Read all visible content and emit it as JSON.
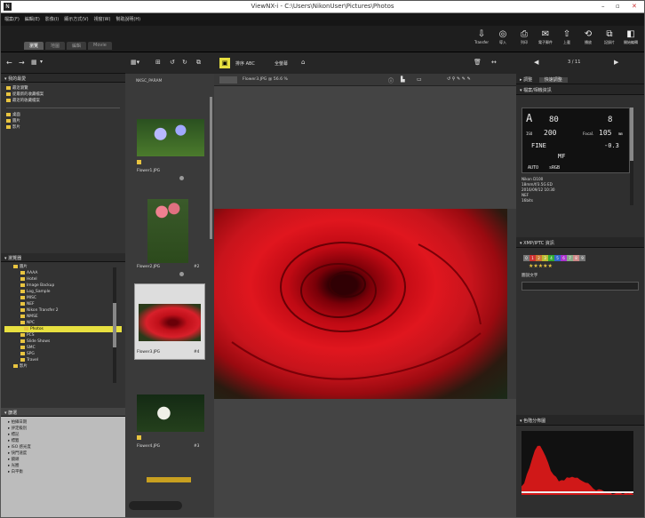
{
  "window": {
    "title": "ViewNX-i - C:\\Users\\NikonUser\\Pictures\\Photos",
    "controls": [
      "–",
      "▫",
      "✕"
    ]
  },
  "menus": [
    "檔案(F)",
    "編輯(E)",
    "影像(I)",
    "顯示方式(V)",
    "視窗(W)",
    "幫助說明(H)"
  ],
  "tabs": [
    "瀏覽",
    "地圖",
    "編輯",
    "Movie"
  ],
  "toolbar": [
    {
      "icon": "transfer-icon",
      "label": "Transfer"
    },
    {
      "icon": "globe-icon",
      "label": "導入"
    },
    {
      "icon": "print-icon",
      "label": "列印"
    },
    {
      "icon": "mail-icon",
      "label": "電子郵件"
    },
    {
      "icon": "upload-icon",
      "label": "上載"
    },
    {
      "icon": "rotate-icon",
      "label": "播放"
    },
    {
      "icon": "copy-icon",
      "label": "記錄片"
    },
    {
      "icon": "nx-icon",
      "label": "開始編輯"
    }
  ],
  "left": {
    "nav": [
      "←",
      "→",
      "▦",
      "▾"
    ],
    "fav_header": "我的最愛",
    "fav_items": [
      "最近瀏覽",
      "從最新的收藏檔案",
      "最近的收藏檔案"
    ],
    "fav2": [
      "桌面",
      "圖片",
      "影片"
    ],
    "folders_header": "瀏覽器",
    "tree": [
      "圖片",
      "AAAA",
      "Hotel",
      "Image Backup",
      "Log_Sample",
      "MISC",
      "NEF",
      "Nikon Transfer 2",
      "NMSE",
      "NPC",
      "Photos",
      "PCS",
      "Slide Shows",
      "SMC",
      "SPG",
      "Travel",
      "影片"
    ],
    "filter_header": "篩選",
    "filters": [
      "拍攝日期",
      "評定級別",
      "標記",
      "標籤",
      "ISO 感光度",
      "快門速度",
      "鏡頭",
      "光圈",
      "白平衡"
    ]
  },
  "strip": {
    "folder": "NKSC_PARAM",
    "thumbs": [
      {
        "name": "Flower1.JPG",
        "count": ""
      },
      {
        "name": "Flower2.JPG",
        "count": "#2"
      },
      {
        "name": "Flower3.JPG",
        "count": "#4"
      },
      {
        "name": "Flower4.JPG",
        "count": "#3"
      }
    ]
  },
  "viewer": {
    "mode": "排序 ABC",
    "file": "Flower3.JPG @ 56.6 %",
    "zoom": "56.6 %",
    "tool_labels": [
      "全螢幕",
      "比較"
    ]
  },
  "right": {
    "nav": "3 / 11",
    "adjust_header": "調整",
    "adjust_value": "快速調整",
    "info_header": "檔案/相機資訊",
    "lcd": {
      "mode": "A",
      "shutter": "80",
      "aperture": "8",
      "iso_label": "ISO",
      "iso": "200",
      "focal_label": "Focal",
      "focal": "105",
      "focal_unit": "mm",
      "quality": "FINE",
      "ev": "-0.3",
      "mf": "MF",
      "wb": "AUTO",
      "cs": "sRGB"
    },
    "meta": [
      "Nikon D100",
      "18mm/f/3.5G ED",
      "2016/09/12 10:30",
      "NEF",
      "16bits"
    ],
    "xmp_header": "XMP/IPTC 資訊",
    "labels": [
      "0",
      "1",
      "2",
      "3",
      "4",
      "5",
      "6",
      "7",
      "8",
      "9"
    ],
    "label_colors": [
      "#777",
      "#c33",
      "#c73",
      "#bb3",
      "#3a3",
      "#36c",
      "#a3c",
      "#8a8",
      "#c88",
      "#777"
    ],
    "stars": "★★★★★",
    "caption_label": "圖說文字",
    "hist_header": "色階分佈圖"
  }
}
